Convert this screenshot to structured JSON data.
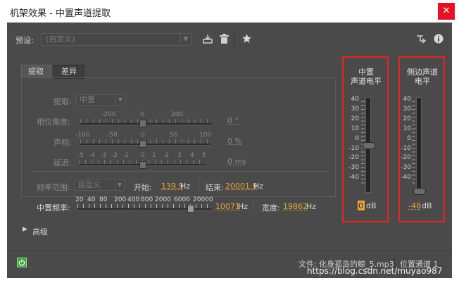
{
  "window": {
    "title": "机架效果 - 中置声道提取",
    "close_glyph": "✕"
  },
  "toolbar": {
    "preset_label": "预设:",
    "preset_value": "(自定义)",
    "icons": [
      "save-preset-icon",
      "delete-preset-icon",
      "favorite-star-icon",
      "routing-icon",
      "info-icon"
    ]
  },
  "tabs": [
    {
      "label": "提取",
      "active": true
    },
    {
      "label": "差异",
      "active": false
    }
  ],
  "extract": {
    "label": "提取:",
    "value": "中置"
  },
  "phase": {
    "label": "相位角度:",
    "ticks": [
      "-200",
      "0",
      "200"
    ],
    "value": "0 °"
  },
  "pan": {
    "label": "声相:",
    "ticks": [
      "-100",
      "-50",
      "0",
      "50",
      "100"
    ],
    "value": "0 %"
  },
  "delay": {
    "label": "延迟:",
    "ticks": [
      "-5",
      "-4",
      "-3",
      "-2",
      "-1",
      "0",
      "1",
      "2",
      "3",
      "4",
      "5"
    ],
    "value": "0 ms"
  },
  "freq_range": {
    "label": "频率范围:",
    "value": "自定义",
    "start_label": "开始:",
    "start_value": "139.9",
    "start_unit": "Hz",
    "end_label": "结束:",
    "end_value": "20001.9",
    "end_unit": "Hz"
  },
  "center_freq": {
    "label": "中置频率:",
    "ticks": [
      "20",
      "40",
      "80",
      "200",
      "400",
      "800",
      "2000",
      "6000",
      "20000"
    ],
    "value": "10071",
    "unit": "Hz",
    "width_label": "宽度:",
    "width_value": "19862",
    "width_unit": "Hz"
  },
  "advanced": {
    "label": "高级"
  },
  "meters": [
    {
      "title_line1": "中置",
      "title_line2": "声道电平",
      "value": "0",
      "unit": "dB",
      "level_db": 0
    },
    {
      "title_line1": "侧边声道",
      "title_line2": "电平",
      "value": "-48",
      "unit": "dB",
      "level_db": -48
    }
  ],
  "meter_scale": [
    "40",
    "30",
    "20",
    "10",
    "0",
    "-10",
    "-20",
    "-30",
    "-40"
  ],
  "status": {
    "file_label": "文件:",
    "file_name": "化身孤岛的鲸_5.mp3",
    "position": "位置通道 1",
    "watermark": "https://blog.csdn.net/muyao987"
  },
  "colors": {
    "accent": "#e8a33a",
    "highlight_box": "#e8251f",
    "panel": "#4a4a4a",
    "power": "#3fa33f"
  }
}
